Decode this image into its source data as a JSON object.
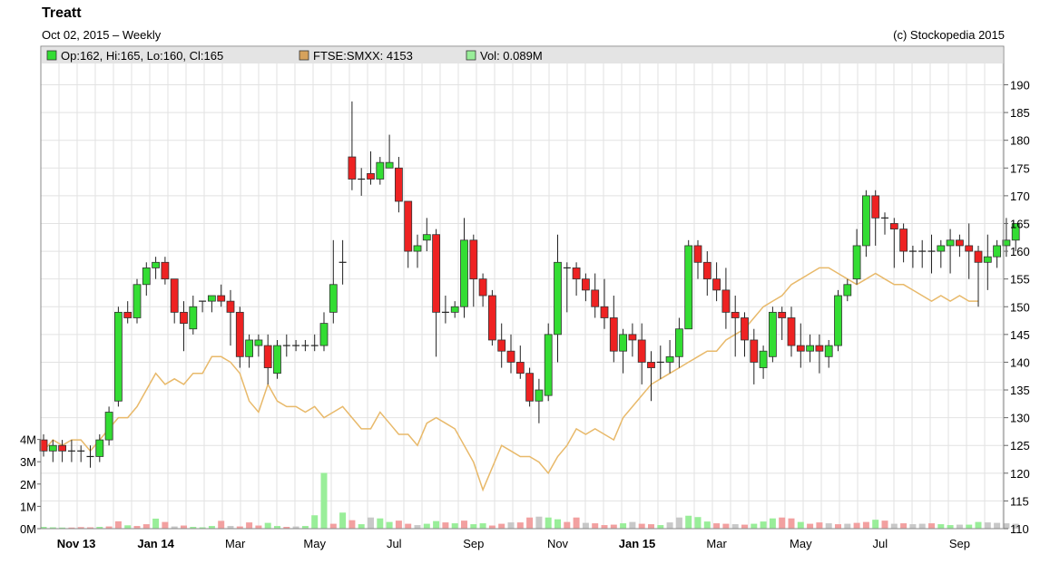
{
  "header": {
    "title": "Treatt",
    "subtitle": "Oct 02, 2015 – Weekly",
    "copyright": "(c) Stockopedia 2015"
  },
  "legend": [
    {
      "label": "Op:162, Hi:165, Lo:160, Cl:165",
      "color": "#33dd33"
    },
    {
      "label": "FTSE:SMXX: 4153",
      "color": "#d6a25c"
    },
    {
      "label": "Vol: 0.089M",
      "color": "#99ee99"
    }
  ],
  "colors": {
    "up": "#33dd33",
    "down": "#ee2222",
    "ftse_line": "#e8b96a",
    "vol_up": "#99ee99",
    "vol_down": "#f2a0a0",
    "vol_neutral": "#c8c8c8",
    "grid": "#e2e2e2"
  },
  "chart_data": {
    "type": "candlestick",
    "price_axis": {
      "min": 110,
      "max": 190,
      "ticks": [
        110,
        115,
        120,
        125,
        130,
        135,
        140,
        145,
        150,
        155,
        160,
        165,
        170,
        175,
        180,
        185,
        190
      ]
    },
    "volume_axis": {
      "ticks": [
        {
          "v": 0,
          "label": "0M"
        },
        {
          "v": 1,
          "label": "1M"
        },
        {
          "v": 2,
          "label": "2M"
        },
        {
          "v": 3,
          "label": "3M"
        },
        {
          "v": 4,
          "label": "4M"
        }
      ]
    },
    "x_tick_labels": [
      {
        "label": "Nov 13",
        "index": 3.5,
        "bold": true
      },
      {
        "label": "Jan 14",
        "index": 12,
        "bold": true
      },
      {
        "label": "Mar",
        "index": 20.5
      },
      {
        "label": "May",
        "index": 29
      },
      {
        "label": "Jul",
        "index": 37.5
      },
      {
        "label": "Sep",
        "index": 46
      },
      {
        "label": "Nov",
        "index": 55
      },
      {
        "label": "Jan 15",
        "index": 63.5,
        "bold": true
      },
      {
        "label": "Mar",
        "index": 72
      },
      {
        "label": "May",
        "index": 81
      },
      {
        "label": "Jul",
        "index": 89.5
      },
      {
        "label": "Sep",
        "index": 98
      }
    ],
    "ohlc": [
      [
        126,
        127,
        123,
        124
      ],
      [
        124,
        126,
        122,
        125
      ],
      [
        125,
        126,
        122,
        124
      ],
      [
        124,
        126,
        122,
        124
      ],
      [
        124,
        125,
        122,
        124
      ],
      [
        123,
        125,
        121,
        123
      ],
      [
        123,
        127,
        122,
        126
      ],
      [
        126,
        132,
        125,
        131
      ],
      [
        133,
        150,
        132,
        149
      ],
      [
        149,
        151,
        147,
        148
      ],
      [
        148,
        155,
        147,
        154
      ],
      [
        154,
        158,
        152,
        157
      ],
      [
        157,
        159,
        155,
        158
      ],
      [
        158,
        159,
        154,
        155
      ],
      [
        155,
        155,
        147,
        149
      ],
      [
        149,
        151,
        142,
        147
      ],
      [
        146,
        152,
        145,
        150
      ],
      [
        151,
        151,
        149,
        151
      ],
      [
        151,
        152,
        149,
        152
      ],
      [
        152,
        154,
        150,
        151
      ],
      [
        151,
        153,
        143,
        149
      ],
      [
        149,
        150,
        139,
        141
      ],
      [
        141,
        145,
        139,
        144
      ],
      [
        143,
        145,
        141,
        144
      ],
      [
        143,
        145,
        136,
        139
      ],
      [
        138,
        144,
        137,
        143
      ],
      [
        143,
        145,
        141,
        143
      ],
      [
        143,
        144,
        142,
        143
      ],
      [
        143,
        144,
        142,
        143
      ],
      [
        143,
        145,
        142,
        143
      ],
      [
        143,
        149,
        142,
        147
      ],
      [
        149,
        162,
        147,
        154
      ],
      [
        158,
        162,
        154,
        158
      ],
      [
        177,
        187,
        171,
        173
      ],
      [
        173,
        175,
        170,
        173
      ],
      [
        174,
        178,
        172,
        173
      ],
      [
        173,
        177,
        172,
        176
      ],
      [
        175,
        181,
        175,
        176
      ],
      [
        175,
        177,
        167,
        169
      ],
      [
        169,
        168,
        157,
        160
      ],
      [
        160,
        163,
        157,
        161
      ],
      [
        162,
        166,
        160,
        163
      ],
      [
        163,
        164,
        141,
        149
      ],
      [
        149,
        152,
        147,
        149
      ],
      [
        149,
        151,
        148,
        150
      ],
      [
        150,
        166,
        148,
        162
      ],
      [
        162,
        163,
        150,
        155
      ],
      [
        155,
        156,
        150,
        152
      ],
      [
        152,
        153,
        143,
        144
      ],
      [
        144,
        147,
        139,
        142
      ],
      [
        142,
        145,
        138,
        140
      ],
      [
        140,
        143,
        137,
        138
      ],
      [
        138,
        139,
        132,
        133
      ],
      [
        133,
        137,
        129,
        135
      ],
      [
        134,
        147,
        133,
        145
      ],
      [
        145,
        163,
        140,
        158
      ],
      [
        157,
        158,
        149,
        157
      ],
      [
        157,
        158,
        152,
        155
      ],
      [
        155,
        156,
        151,
        153
      ],
      [
        153,
        156,
        148,
        150
      ],
      [
        150,
        155,
        146,
        148
      ],
      [
        148,
        152,
        140,
        142
      ],
      [
        142,
        146,
        138,
        145
      ],
      [
        145,
        147,
        141,
        144
      ],
      [
        144,
        147,
        136,
        140
      ],
      [
        140,
        142,
        133,
        139
      ],
      [
        140,
        143,
        137,
        140
      ],
      [
        140,
        144,
        138,
        141
      ],
      [
        141,
        148,
        139,
        146
      ],
      [
        146,
        162,
        146,
        161
      ],
      [
        161,
        162,
        155,
        158
      ],
      [
        158,
        160,
        152,
        155
      ],
      [
        155,
        158,
        151,
        153
      ],
      [
        153,
        157,
        146,
        149
      ],
      [
        149,
        152,
        141,
        148
      ],
      [
        148,
        149,
        141,
        144
      ],
      [
        144,
        146,
        136,
        140
      ],
      [
        139,
        143,
        137,
        142
      ],
      [
        141,
        150,
        140,
        149
      ],
      [
        149,
        150,
        144,
        148
      ],
      [
        148,
        150,
        141,
        143
      ],
      [
        143,
        147,
        139,
        142
      ],
      [
        142,
        145,
        140,
        143
      ],
      [
        143,
        145,
        138,
        142
      ],
      [
        141,
        144,
        139,
        143
      ],
      [
        143,
        153,
        142,
        152
      ],
      [
        152,
        155,
        151,
        154
      ],
      [
        155,
        164,
        154,
        161
      ],
      [
        161,
        171,
        159,
        170
      ],
      [
        170,
        171,
        161,
        166
      ],
      [
        166,
        167,
        163,
        166
      ],
      [
        165,
        166,
        157,
        164
      ],
      [
        164,
        165,
        158,
        160
      ],
      [
        160,
        161,
        157,
        160
      ],
      [
        160,
        162,
        157,
        160
      ],
      [
        160,
        163,
        156,
        160
      ],
      [
        160,
        162,
        157,
        161
      ],
      [
        161,
        164,
        156,
        162
      ],
      [
        162,
        163,
        159,
        161
      ],
      [
        161,
        165,
        155,
        160
      ],
      [
        160,
        161,
        150,
        158
      ],
      [
        158,
        163,
        153,
        159
      ],
      [
        159,
        162,
        157,
        161
      ],
      [
        161,
        166,
        159,
        162
      ],
      [
        162,
        165,
        160,
        165
      ]
    ],
    "ftse": [
      124,
      126,
      125,
      126,
      126,
      124,
      126,
      128,
      130,
      130,
      132,
      135,
      138,
      136,
      137,
      136,
      138,
      138,
      141,
      141,
      140,
      138,
      133,
      131,
      136,
      133,
      132,
      132,
      131,
      132,
      130,
      131,
      132,
      130,
      128,
      128,
      131,
      129,
      127,
      127,
      125,
      129,
      130,
      129,
      128,
      125,
      122,
      117,
      121,
      125,
      124,
      123,
      123,
      122,
      120,
      123,
      125,
      128,
      127,
      128,
      127,
      126,
      130,
      132,
      134,
      136,
      137,
      138,
      139,
      140,
      141,
      142,
      142,
      144,
      145,
      146,
      148,
      150,
      151,
      152,
      154,
      155,
      156,
      157,
      157,
      156,
      155,
      154,
      155,
      156,
      155,
      154,
      154,
      153,
      152,
      151,
      152,
      151,
      152,
      151,
      151
    ],
    "volume": [
      0.08,
      0.06,
      0.05,
      0.05,
      0.07,
      0.06,
      0.08,
      0.1,
      0.33,
      0.15,
      0.12,
      0.2,
      0.45,
      0.3,
      0.1,
      0.14,
      0.08,
      0.06,
      0.12,
      0.35,
      0.12,
      0.1,
      0.28,
      0.14,
      0.26,
      0.12,
      0.08,
      0.1,
      0.12,
      0.6,
      2.5,
      0.22,
      0.72,
      0.38,
      0.2,
      0.5,
      0.46,
      0.3,
      0.36,
      0.22,
      0.16,
      0.22,
      0.34,
      0.28,
      0.24,
      0.36,
      0.2,
      0.24,
      0.14,
      0.22,
      0.28,
      0.28,
      0.5,
      0.54,
      0.5,
      0.42,
      0.3,
      0.5,
      0.26,
      0.24,
      0.16,
      0.18,
      0.24,
      0.3,
      0.22,
      0.2,
      0.16,
      0.28,
      0.5,
      0.58,
      0.52,
      0.32,
      0.24,
      0.22,
      0.2,
      0.18,
      0.22,
      0.32,
      0.46,
      0.5,
      0.46,
      0.3,
      0.22,
      0.28,
      0.24,
      0.2,
      0.22,
      0.26,
      0.3,
      0.4,
      0.36,
      0.22,
      0.24,
      0.2,
      0.22,
      0.24,
      0.2,
      0.16,
      0.18,
      0.18,
      0.3,
      0.28,
      0.26,
      0.24,
      0.22
    ],
    "volume_flags": "uuudddudduddudnduuudnddduudnuuududunuuddnuududuuddnddnuuddndddunddunnuuuddnduuudduddndnddudndnnduunuunn"
  }
}
